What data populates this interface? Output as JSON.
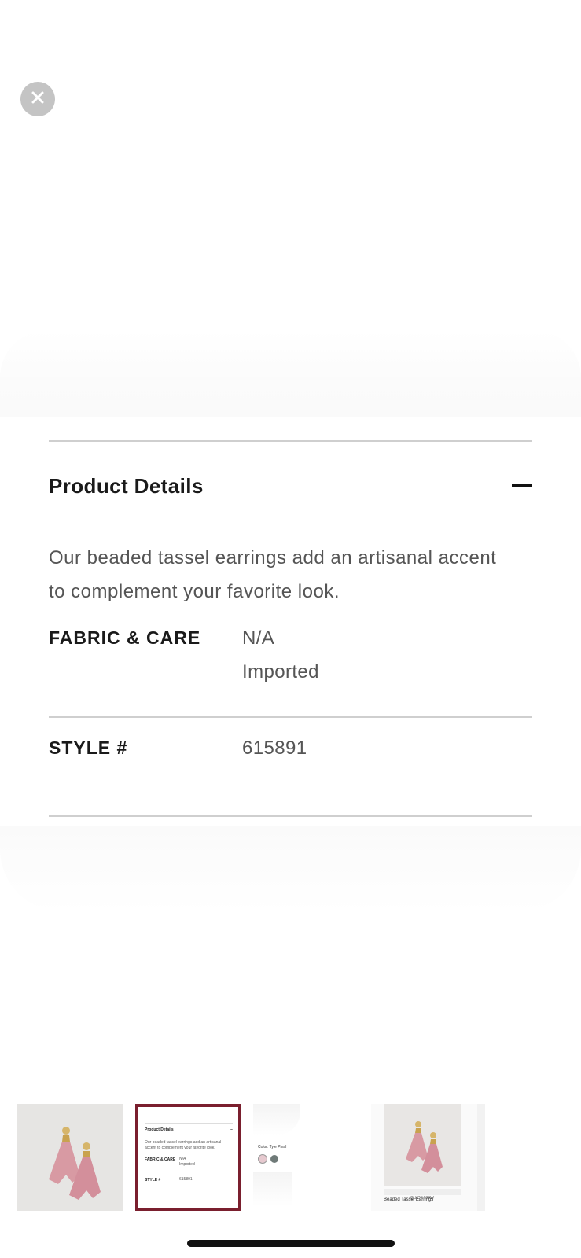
{
  "product_details": {
    "title": "Product Details",
    "description": "Our beaded tassel earrings add an artisanal accent to complement your favorite look.",
    "fabric_care": {
      "label": "FABRIC & CARE",
      "values": [
        "N/A",
        "Imported"
      ]
    },
    "style": {
      "label": "STYLE #",
      "value": "615891"
    }
  },
  "thumbnails": [
    {
      "kind": "product-image"
    },
    {
      "kind": "product-details",
      "title": "Product Details",
      "description": "Our beaded tassel earrings add an artisanal accent to complement your favorite look.",
      "fabric_label": "FABRIC & CARE",
      "fabric_values": [
        "N/A",
        "Imported"
      ],
      "style_label": "STYLE #",
      "style_value": "615891"
    },
    {
      "kind": "color",
      "label": "Color: Tyle Pinal"
    },
    {
      "kind": "related",
      "quick_view": "QUICK VIEW",
      "name": "Beaded Tassel Earrings"
    }
  ],
  "colors": {
    "selected_border": "#7a1f2e",
    "close_button_bg": "#c4c4c4",
    "swatch_pink": "#e6c9cf",
    "swatch_gray": "#6f7a78"
  },
  "icons": {
    "close": "close-icon",
    "collapse": "minus-icon"
  }
}
